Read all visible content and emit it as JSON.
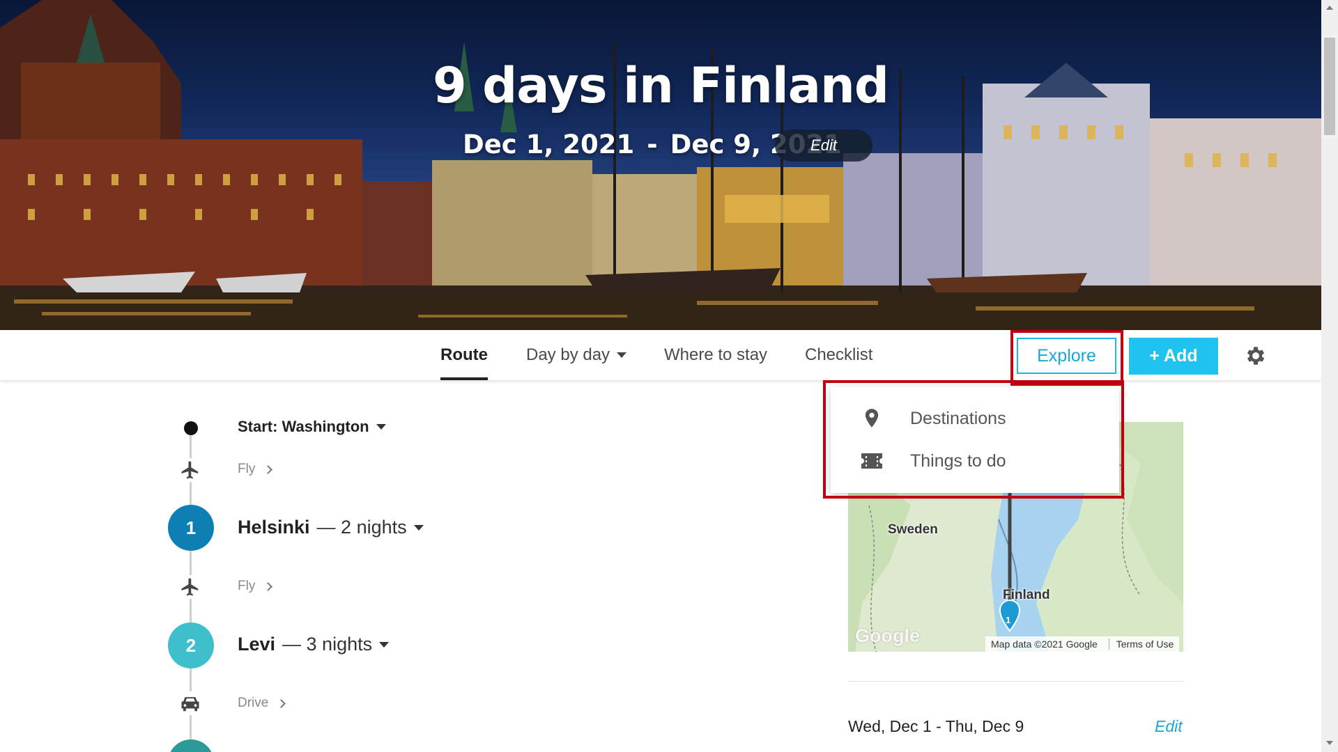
{
  "hero": {
    "title": "9 days in Finland",
    "start_date": "Dec 1, 2021",
    "separator": "-",
    "end_date": "Dec 9, 2021",
    "edit_label": "Edit"
  },
  "nav": {
    "tabs": [
      {
        "label": "Route",
        "active": true
      },
      {
        "label": "Day by day",
        "active": false,
        "has_caret": true
      },
      {
        "label": "Where to stay",
        "active": false
      },
      {
        "label": "Checklist",
        "active": false
      }
    ],
    "explore_label": "Explore",
    "add_label": "+ Add",
    "settings_icon": "gear-icon"
  },
  "explore_menu": {
    "items": [
      {
        "label": "Destinations",
        "icon": "map-pin-icon"
      },
      {
        "label": "Things to do",
        "icon": "ticket-icon"
      }
    ]
  },
  "route": {
    "start": {
      "label": "Start: Washington"
    },
    "legs": [
      {
        "mode": "Fly",
        "icon": "plane-icon"
      },
      {
        "mode": "Fly",
        "icon": "plane-icon"
      },
      {
        "mode": "Drive",
        "icon": "car-icon"
      }
    ],
    "stops": [
      {
        "number": "1",
        "city": "Helsinki",
        "nights": "— 2 nights",
        "color": "#0e7fb5"
      },
      {
        "number": "2",
        "city": "Levi",
        "nights": "— 3 nights",
        "color": "#3fbfcb"
      },
      {
        "number": "",
        "city": "",
        "nights": "",
        "color": "#2b9a98"
      }
    ]
  },
  "map": {
    "labels": [
      "Sweden",
      "Finland"
    ],
    "marker": "1",
    "logo": "Google",
    "attribution": "Map data ©2021 Google",
    "terms": "Terms of Use"
  },
  "sidebar": {
    "dates": "Wed, Dec 1 - Thu, Dec 9",
    "edit_label": "Edit"
  },
  "colors": {
    "accent": "#1ec3ee",
    "highlight": "#c00010"
  }
}
